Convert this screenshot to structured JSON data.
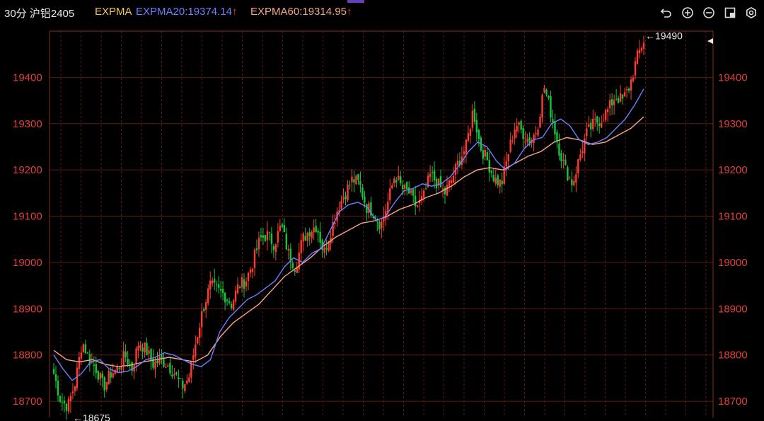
{
  "header": {
    "title": "30分 沪铝2405",
    "indicator_name": "EXPMA",
    "ema20_label": "EXPMA20:19374.14",
    "ema60_label": "EXPMA60:19314.95",
    "up_arrow": "↑"
  },
  "toolbar": {
    "icons": [
      "undo-icon",
      "zoom-in-icon",
      "zoom-out-icon",
      "layout-icon",
      "settings-icon"
    ]
  },
  "colors": {
    "up": "#ff3b30",
    "down": "#12c73a",
    "ema20": "#6f7fff",
    "ema60": "#f4a58a",
    "grid": "#5a1a14",
    "vgrid": "#5a1a14",
    "axis_text": "#e0403a"
  },
  "chart_data": {
    "type": "candlestick",
    "ylim": [
      18665,
      19500
    ],
    "yticks": [
      18700,
      18800,
      18900,
      19000,
      19100,
      19200,
      19300,
      19400
    ],
    "ytick_labels": [
      "18700",
      "18800",
      "18900",
      "19000",
      "19100",
      "19200",
      "19300",
      "19400"
    ],
    "max_label": "←19490",
    "min_label": "←18675",
    "max_value": 19490,
    "min_value": 18675,
    "key_close": [
      18760,
      18700,
      18690,
      18740,
      18830,
      18790,
      18770,
      18730,
      18760,
      18770,
      18800,
      18770,
      18830,
      18810,
      18780,
      18790,
      18780,
      18760,
      18730,
      18750,
      18830,
      18900,
      18950,
      18940,
      18930,
      18910,
      18950,
      18960,
      19000,
      19050,
      19060,
      19040,
      19080,
      19020,
      18990,
      19050,
      19070,
      19080,
      19020,
      19070,
      19120,
      19150,
      19180,
      19170,
      19120,
      19110,
      19080,
      19130,
      19190,
      19160,
      19150,
      19120,
      19140,
      19190,
      19170,
      19150,
      19180,
      19220,
      19250,
      19330,
      19250,
      19220,
      19180,
      19170,
      19240,
      19300,
      19280,
      19260,
      19290,
      19380,
      19320,
      19250,
      19200,
      19170,
      19230,
      19280,
      19300,
      19310,
      19330,
      19360,
      19350,
      19380,
      19440,
      19480
    ],
    "ema20": [
      18800,
      18770,
      18745,
      18760,
      18785,
      18790,
      18770,
      18762,
      18765,
      18775,
      18790,
      18795,
      18805,
      18800,
      18790,
      18780,
      18775,
      18790,
      18850,
      18880,
      18900,
      18920,
      18930,
      18945,
      18960,
      18990,
      19010,
      19000,
      19020,
      19030,
      19070,
      19110,
      19125,
      19130,
      19120,
      19090,
      19100,
      19130,
      19155,
      19160,
      19170,
      19165,
      19170,
      19185,
      19210,
      19240,
      19260,
      19250,
      19220,
      19200,
      19215,
      19245,
      19265,
      19270,
      19300,
      19310,
      19295,
      19265,
      19255,
      19260,
      19270,
      19290,
      19310,
      19340,
      19375
    ],
    "ema60": [
      18810,
      18790,
      18785,
      18790,
      18780,
      18775,
      18778,
      18785,
      18790,
      18795,
      18790,
      18785,
      18800,
      18840,
      18870,
      18890,
      18910,
      18940,
      18970,
      18990,
      19010,
      19035,
      19055,
      19070,
      19085,
      19090,
      19100,
      19115,
      19125,
      19140,
      19150,
      19165,
      19185,
      19200,
      19205,
      19200,
      19215,
      19230,
      19240,
      19260,
      19270,
      19265,
      19255,
      19260,
      19275,
      19290,
      19315
    ]
  }
}
